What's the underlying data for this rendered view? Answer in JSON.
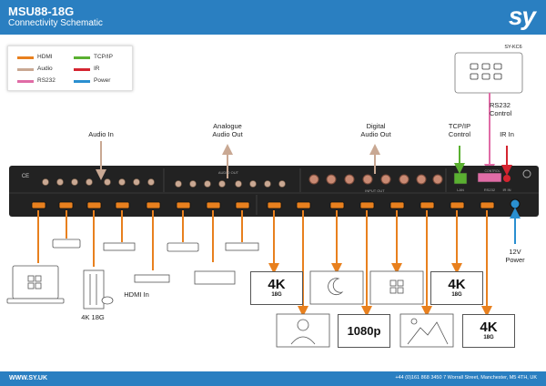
{
  "header": {
    "title": "MSU88-18G",
    "subtitle": "Connectivity Schematic",
    "logo": "sy"
  },
  "legend": [
    {
      "label": "HDMI",
      "color": "#e8801e"
    },
    {
      "label": "TCP/IP",
      "color": "#5ab031"
    },
    {
      "label": "Audio",
      "color": "#c9a893"
    },
    {
      "label": "IR",
      "color": "#d42430"
    },
    {
      "label": "RS232",
      "color": "#e06ca6"
    },
    {
      "label": "Power",
      "color": "#2a8fd0"
    }
  ],
  "labels": {
    "audio_in": "Audio In",
    "analogue_audio_out": "Analogue\nAudio Out",
    "digital_audio_out": "Digital\nAudio Out",
    "tcpip_control": "TCP/IP\nControl",
    "ir_in": "IR In",
    "rs232_control": "RS232\nControl",
    "kc6": "SY-KC6",
    "power": "12V\nPower",
    "hdmi_in": "HDMI In",
    "console": "4K 18G"
  },
  "device": {
    "analog_out_label": "AUDIO OUT",
    "digital_label": "INPUT OUT",
    "lan": "LAN",
    "rs232": "RS232",
    "ir": "IR IN",
    "ce": "CE",
    "control": "CONTROL"
  },
  "screens": [
    {
      "text": "4K",
      "sub": "18G"
    },
    {
      "text": "4K",
      "sub": "18G"
    },
    {
      "text": "1080p",
      "sub": ""
    },
    {
      "text": "4K",
      "sub": "18G"
    }
  ],
  "footer": {
    "website": "WWW.SY.UK",
    "address": "+44 (0)161 868 3450 7 Worrall Street, Manchester, M5 4TH, UK"
  }
}
